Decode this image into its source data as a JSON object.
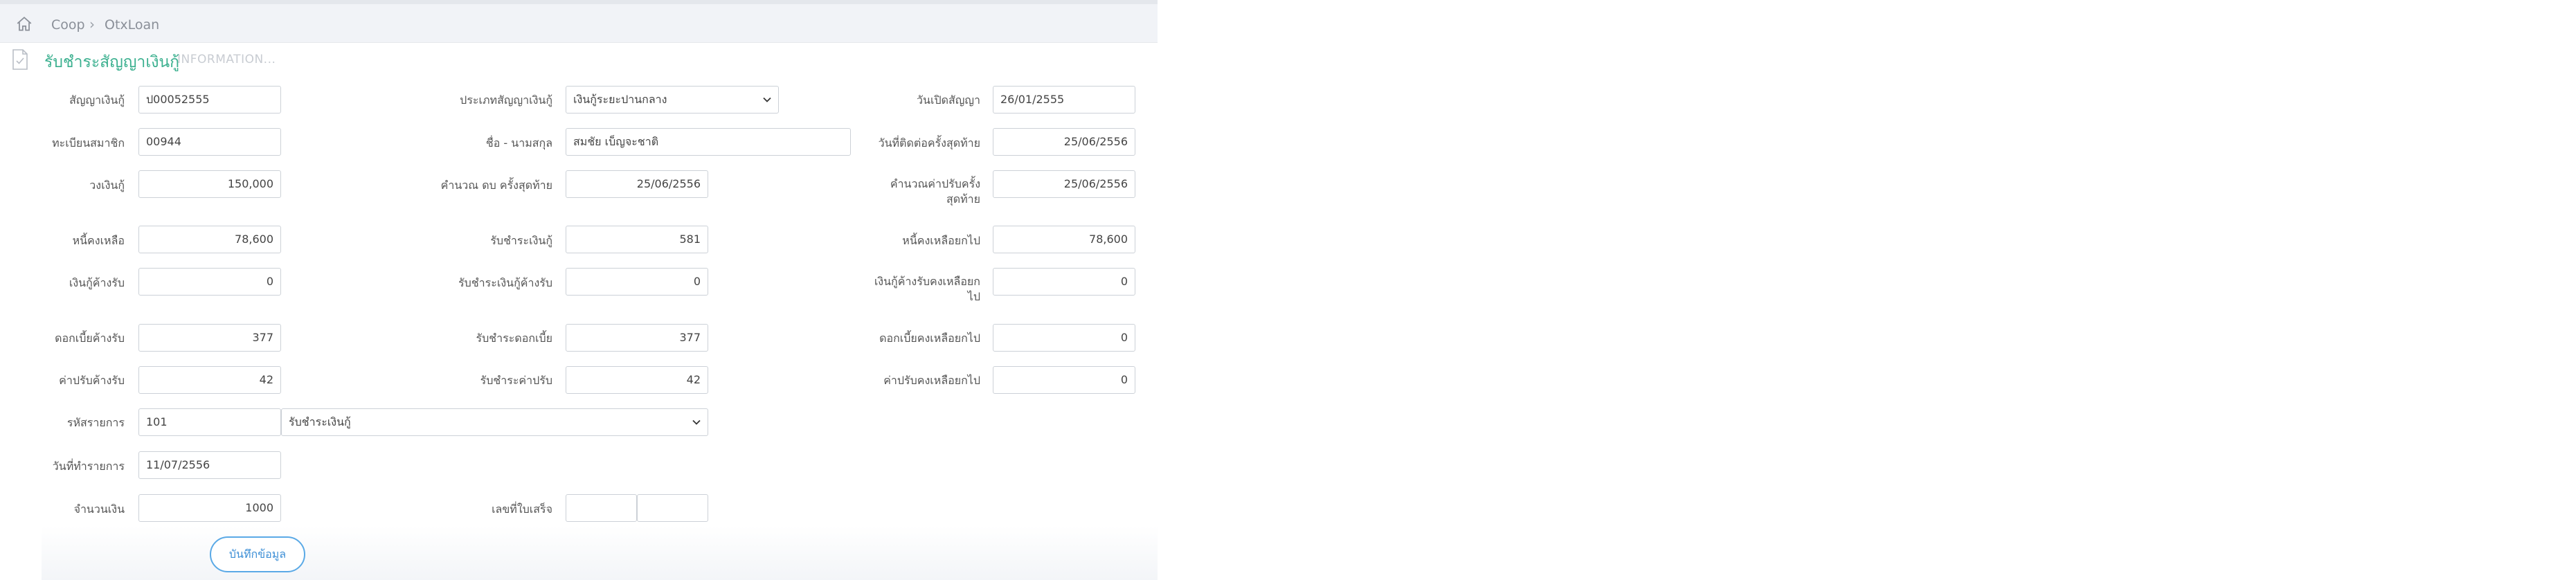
{
  "breadcrumb": {
    "items": [
      "Coop",
      "OtxLoan"
    ],
    "separator": "›"
  },
  "page": {
    "title": "รับชำระสัญญาเงินกู้",
    "subtitle": "INFORMATION..."
  },
  "form": {
    "contract_no": {
      "label": "สัญญาเงินกู้",
      "value": "ป00052555"
    },
    "loan_type": {
      "label": "ประเภทสัญญาเงินกู้",
      "value": "เงินกู้ระยะปานกลาง"
    },
    "open_date": {
      "label": "วันเปิดสัญญา",
      "value": "26/01/2555"
    },
    "member_no": {
      "label": "ทะเบียนสมาชิก",
      "value": "00944"
    },
    "member_name": {
      "label": "ชื่อ - นามสกุล",
      "value": "สมชัย  เบ็ญจะชาติ"
    },
    "last_contact_date": {
      "label": "วันที่ติดต่อครั้งสุดท้าย",
      "value": "25/06/2556"
    },
    "credit_limit": {
      "label": "วงเงินกู้",
      "value": "150,000"
    },
    "last_interest_calc": {
      "label": "คำนวณ ดบ ครั้งสุดท้าย",
      "value": "25/06/2556"
    },
    "last_fine_calc": {
      "label": "คำนวณค่าปรับครั้งสุดท้าย",
      "value": "25/06/2556"
    },
    "principal_balance": {
      "label": "หนี้คงเหลือ",
      "value": "78,600"
    },
    "loan_payment": {
      "label": "รับชำระเงินกู้",
      "value": "581"
    },
    "carry_balance": {
      "label": "หนี้คงเหลือยกไป",
      "value": "78,600"
    },
    "loan_arrears": {
      "label": "เงินกู้ค้างรับ",
      "value": "0"
    },
    "loan_arrears_payment": {
      "label": "รับชำระเงินกู้ค้างรับ",
      "value": "0"
    },
    "loan_arrears_carry": {
      "label": "เงินกู้ค้างรับคงเหลือยกไป",
      "value": "0"
    },
    "interest_arrears": {
      "label": "ดอกเบี้ยค้างรับ",
      "value": "377"
    },
    "interest_payment": {
      "label": "รับชำระดอกเบี้ย",
      "value": "377"
    },
    "interest_carry": {
      "label": "ดอกเบี้ยคงเหลือยกไป",
      "value": "0"
    },
    "fine_arrears": {
      "label": "ค่าปรับค้างรับ",
      "value": "42"
    },
    "fine_payment": {
      "label": "รับชำระค่าปรับ",
      "value": "42"
    },
    "fine_carry": {
      "label": "ค่าปรับคงเหลือยกไป",
      "value": "0"
    },
    "transaction_code": {
      "label": "รหัสรายการ",
      "value": "101",
      "description": "รับชำระเงินกู้"
    },
    "transaction_date": {
      "label": "วันที่ทำรายการ",
      "value": "11/07/2556"
    },
    "amount": {
      "label": "จำนวนเงิน",
      "value": "1000"
    },
    "receipt_no": {
      "label": "เลขที่ใบเสร็จ",
      "value_1": "",
      "value_2": ""
    }
  },
  "actions": {
    "save_label": "บันทึกข้อมูล"
  },
  "colors": {
    "title": "#3bb08f",
    "button": "#3d8fd6"
  }
}
